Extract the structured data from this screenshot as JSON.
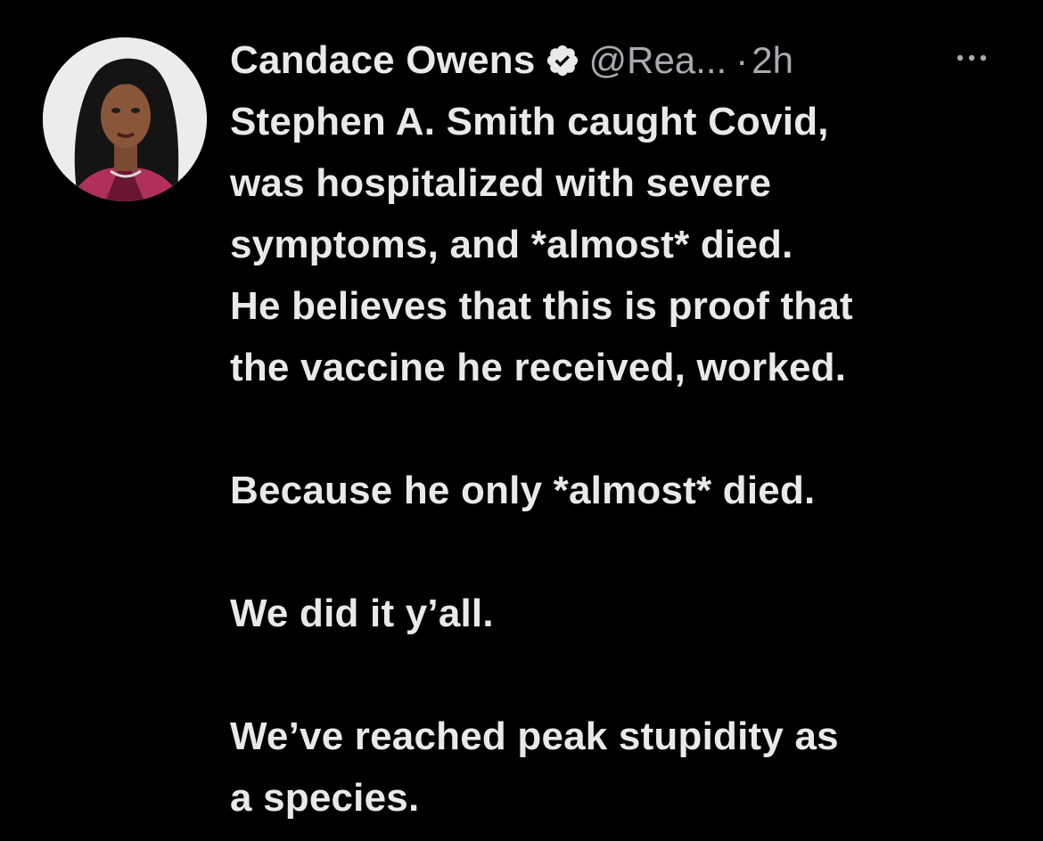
{
  "author": {
    "display_name": "Candace Owens",
    "handle": "@Rea...",
    "separator": "·",
    "timestamp": "2h",
    "verified": true
  },
  "icons": {
    "verified": "verified-badge-icon",
    "more": "more-horizontal-icon",
    "avatar": "profile-photo"
  },
  "colors": {
    "background": "#000000",
    "primary_text": "#e7e9ea",
    "secondary_text": "#a7abaf"
  },
  "tweet": {
    "paragraphs": [
      {
        "lines": [
          "Stephen A. Smith caught Covid,",
          "was hospitalized with severe",
          "symptoms, and *almost* died.",
          "He believes that this is proof that",
          "the vaccine he received, worked."
        ]
      },
      {
        "lines": [
          "Because he only *almost* died."
        ]
      },
      {
        "lines": [
          "We did it y’all."
        ]
      },
      {
        "lines": [
          "We’ve reached peak stupidity as",
          "a species."
        ]
      }
    ]
  }
}
